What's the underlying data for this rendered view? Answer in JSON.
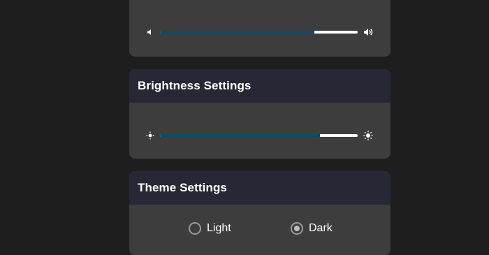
{
  "volume_card": {
    "level": 0.78,
    "low_icon": "volume-low-icon",
    "high_icon": "volume-high-icon"
  },
  "brightness_card": {
    "title": "Brightness Settings",
    "level": 0.81,
    "low_icon": "brightness-low-icon",
    "high_icon": "brightness-high-icon"
  },
  "theme_card": {
    "title": "Theme Settings",
    "options": [
      {
        "label": "Light",
        "selected": false
      },
      {
        "label": "Dark",
        "selected": true
      }
    ]
  },
  "colors": {
    "background": "#1e1e1e",
    "card": "#3d3d3d",
    "header": "#262836",
    "slider_fill": "#0e4a63",
    "slider_track": "#ffffff"
  }
}
